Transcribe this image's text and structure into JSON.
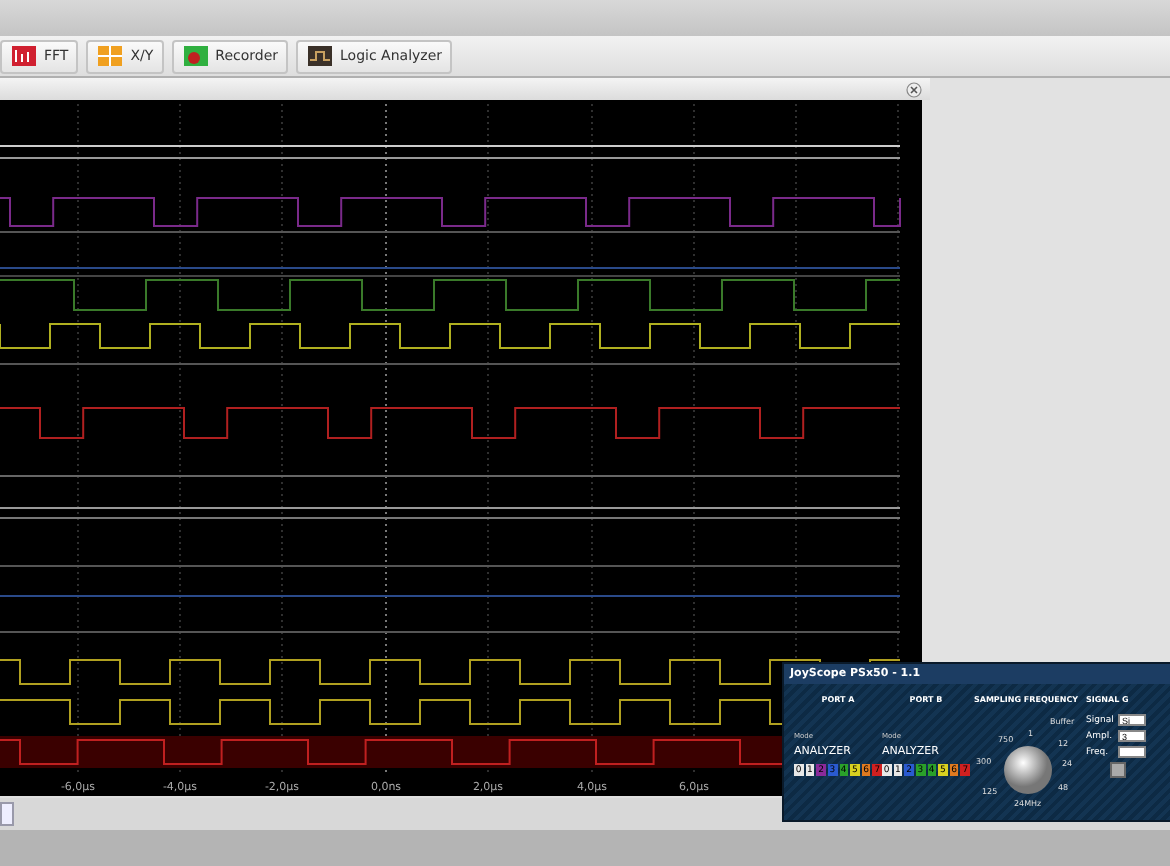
{
  "toolbar": [
    {
      "label": "FFT",
      "kind": "fft"
    },
    {
      "label": "X/Y",
      "kind": "xy"
    },
    {
      "label": "Recorder",
      "kind": "recorder"
    },
    {
      "label": "Logic Analyzer",
      "kind": "logic"
    }
  ],
  "scope": {
    "x_labels": [
      "-6,0µs",
      "-4,0µs",
      "-2,0µs",
      "0,0ns",
      "2,0µs",
      "4,0µs",
      "6,0µs"
    ]
  },
  "panel": {
    "title": "JoyScope PSx50 - 1.1",
    "ports": [
      {
        "heading": "PORT A",
        "mode_label": "Mode",
        "mode": "ANALYZER",
        "bits": [
          {
            "label": "0",
            "color": "#e8e8e8"
          },
          {
            "label": "1",
            "color": "#e8e8e8"
          },
          {
            "label": "2",
            "color": "#8a2a9a"
          },
          {
            "label": "3",
            "color": "#2a5ad0"
          },
          {
            "label": "4",
            "color": "#2aa02a"
          },
          {
            "label": "5",
            "color": "#d8d020"
          },
          {
            "label": "6",
            "color": "#e07a20"
          },
          {
            "label": "7",
            "color": "#d02020"
          }
        ]
      },
      {
        "heading": "PORT B",
        "mode_label": "Mode",
        "mode": "ANALYZER",
        "bits": [
          {
            "label": "0",
            "color": "#e8e8e8"
          },
          {
            "label": "1",
            "color": "#e8e8e8"
          },
          {
            "label": "2",
            "color": "#2a5ad0"
          },
          {
            "label": "3",
            "color": "#2aa02a"
          },
          {
            "label": "4",
            "color": "#2aa02a"
          },
          {
            "label": "5",
            "color": "#d8d020"
          },
          {
            "label": "6",
            "color": "#e07a20"
          },
          {
            "label": "7",
            "color": "#d02020"
          }
        ]
      }
    ],
    "sampling": {
      "heading": "SAMPLING FREQUENCY",
      "buffer_label": "Buffer",
      "reading": "24MHz",
      "ticks": [
        "750",
        "1",
        "12",
        "24",
        "48",
        "300",
        "125"
      ]
    },
    "signal": {
      "heading": "SIGNAL G",
      "fields": [
        {
          "label": "Signal",
          "value": "Si"
        },
        {
          "label": "Ampl.",
          "value": "3"
        },
        {
          "label": "Freq."
        }
      ]
    }
  }
}
